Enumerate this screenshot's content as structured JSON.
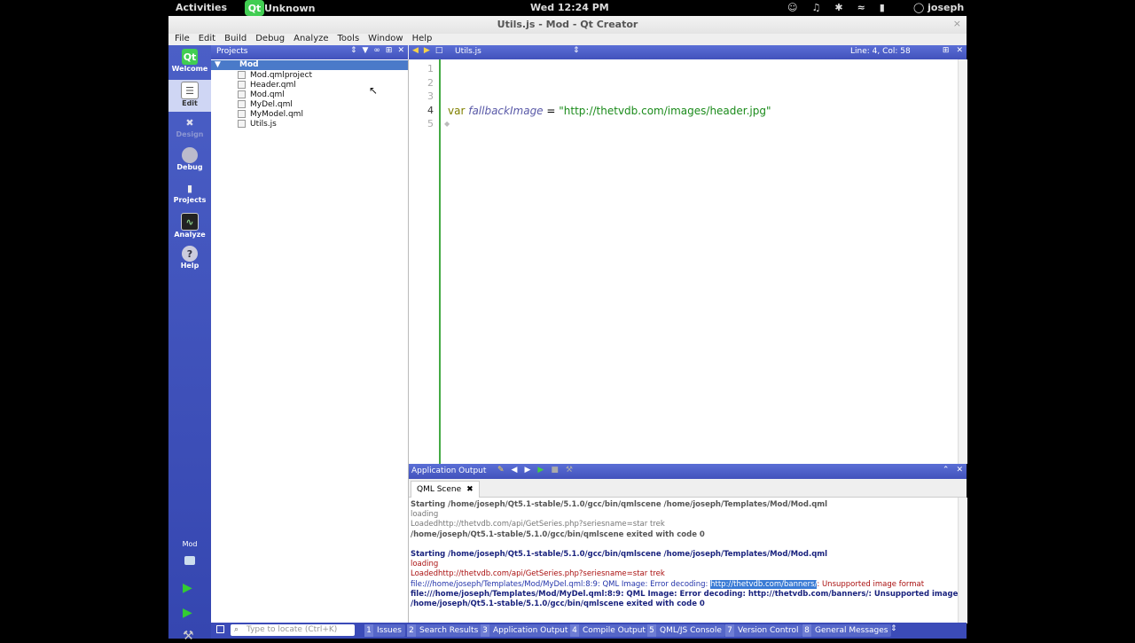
{
  "topbar": {
    "activities": "Activities",
    "app_name": "Unknown",
    "clock": "Wed 12:24 PM",
    "user": "joseph"
  },
  "window": {
    "title": "Utils.js - Mod - Qt Creator",
    "close": "×"
  },
  "menu": [
    "File",
    "Edit",
    "Build",
    "Debug",
    "Analyze",
    "Tools",
    "Window",
    "Help"
  ],
  "modes": {
    "welcome": "Welcome",
    "edit": "Edit",
    "design": "Design",
    "debug": "Debug",
    "projects": "Projects",
    "analyze": "Analyze",
    "help": "Help",
    "kit": "Mod"
  },
  "projects": {
    "header": "Projects",
    "root": "Mod",
    "files": [
      "Mod.qmlproject",
      "Header.qml",
      "Mod.qml",
      "MyDel.qml",
      "MyModel.qml",
      "Utils.js"
    ]
  },
  "editor": {
    "document": "Utils.js",
    "position": "Line: 4, Col: 58",
    "lines": [
      "1",
      "2",
      "3",
      "4",
      "5"
    ],
    "code": {
      "keyword": "var",
      "identifier": "fallbackImage",
      "operator": " = ",
      "string": "\"http://thetvdb.com/images/header.jpg\""
    }
  },
  "output": {
    "header": "Application Output",
    "tab": "QML Scene",
    "lines": {
      "l1": "Starting /home/joseph/Qt5.1-stable/5.1.0/gcc/bin/qmlscene /home/joseph/Templates/Mod/Mod.qml",
      "l2": "loading",
      "l3": "Loadedhttp://thetvdb.com/api/GetSeries.php?seriesname=star trek",
      "l4": "/home/joseph/Qt5.1-stable/5.1.0/gcc/bin/qmlscene exited with code 0",
      "l5": "Starting /home/joseph/Qt5.1-stable/5.1.0/gcc/bin/qmlscene /home/joseph/Templates/Mod/Mod.qml",
      "l6": "loading",
      "l7": "Loadedhttp://thetvdb.com/api/GetSeries.php?seriesname=star trek",
      "l8a": "file:///home/joseph/Templates/Mod/MyDel.qml:8:9: QML Image: Error decoding: ",
      "l8b": "http://thetvdb.com/banners/",
      "l8c": ": Unsupported image format",
      "l9": "file:///home/joseph/Templates/Mod/MyDel.qml:8:9: QML Image: Error decoding: http://thetvdb.com/banners/: Unsupported image format",
      "l10": "/home/joseph/Qt5.1-stable/5.1.0/gcc/bin/qmlscene exited with code 0"
    }
  },
  "statusbar": {
    "locator_placeholder": "Type to locate (Ctrl+K)",
    "panes": [
      {
        "n": "1",
        "label": "Issues"
      },
      {
        "n": "2",
        "label": "Search Results"
      },
      {
        "n": "3",
        "label": "Application Output"
      },
      {
        "n": "4",
        "label": "Compile Output"
      },
      {
        "n": "5",
        "label": "QML/JS Console"
      },
      {
        "n": "7",
        "label": "Version Control"
      },
      {
        "n": "8",
        "label": "General Messages"
      }
    ]
  },
  "colors": {
    "accent": "#4252bc",
    "selection": "#4a7ac9",
    "string": "#1b8b1b",
    "keyword": "#808000"
  }
}
